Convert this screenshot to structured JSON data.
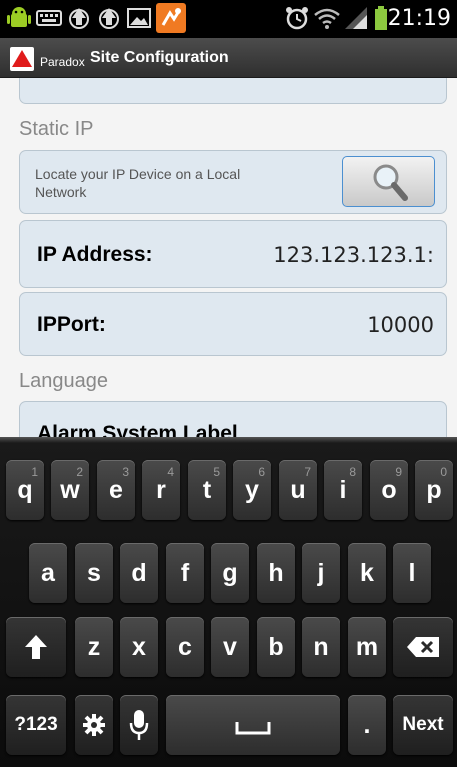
{
  "status_bar": {
    "time": "21:19",
    "icons": [
      "android-debug-icon",
      "keyboard-icon",
      "recycle-icon",
      "recycle-icon",
      "image-icon",
      "phone-app-icon",
      "alarm-icon",
      "wifi-icon",
      "signal-icon",
      "battery-icon"
    ]
  },
  "app_bar": {
    "app_name": "Paradox",
    "title": "Site Configuration",
    "logo_color": "#e01b1b"
  },
  "form": {
    "section_static_ip": "Static IP",
    "locate_text": "Locate your IP Device on a Local Network",
    "ip_address_label": "IP Address:",
    "ip_address_value": "123.123.123.1:",
    "ip_port_label": "IPPort:",
    "ip_port_value": "10000",
    "section_language": "Language",
    "alarm_system_label": "Alarm System Label"
  },
  "keyboard": {
    "row1": [
      {
        "key": "q",
        "hint": "1"
      },
      {
        "key": "w",
        "hint": "2"
      },
      {
        "key": "e",
        "hint": "3"
      },
      {
        "key": "r",
        "hint": "4"
      },
      {
        "key": "t",
        "hint": "5"
      },
      {
        "key": "y",
        "hint": "6"
      },
      {
        "key": "u",
        "hint": "7"
      },
      {
        "key": "i",
        "hint": "8"
      },
      {
        "key": "o",
        "hint": "9"
      },
      {
        "key": "p",
        "hint": "0"
      }
    ],
    "row2": [
      "a",
      "s",
      "d",
      "f",
      "g",
      "h",
      "j",
      "k",
      "l"
    ],
    "row3": [
      "z",
      "x",
      "c",
      "v",
      "b",
      "n",
      "m"
    ],
    "mode_key": "?123",
    "period_key": ".",
    "next_key": "Next"
  }
}
